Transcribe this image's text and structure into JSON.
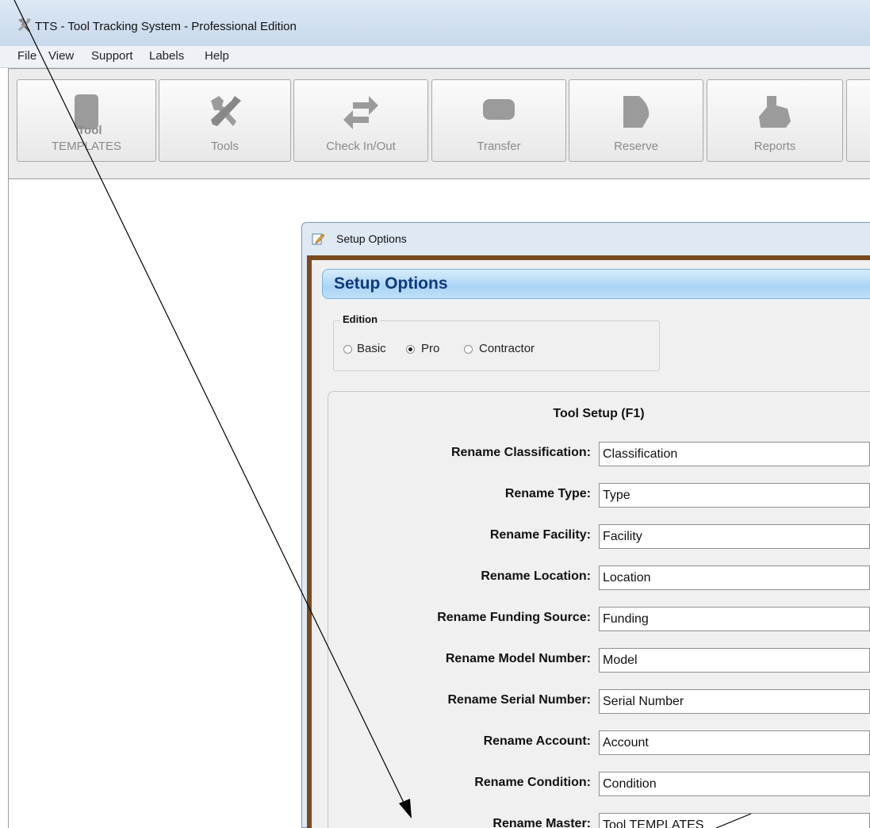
{
  "window": {
    "title": "TTS - Tool Tracking System - Professional Edition",
    "icon": "tools-app-icon"
  },
  "menu": {
    "items": [
      "File",
      "View",
      "Support",
      "Labels",
      "Help"
    ]
  },
  "toolbar": {
    "buttons": [
      {
        "label": "TEMPLATES",
        "overlay": "Tool",
        "icon": "template-icon"
      },
      {
        "label": "Tools",
        "icon": "wrench-screwdriver-icon"
      },
      {
        "label": "Check In/Out",
        "icon": "swap-arrows-icon"
      },
      {
        "label": "Transfer",
        "icon": "truck-icon"
      },
      {
        "label": "Reserve",
        "icon": "reserve-icon"
      },
      {
        "label": "Reports",
        "icon": "reports-icon"
      }
    ]
  },
  "dialog": {
    "title": "Setup Options",
    "header": "Setup Options",
    "edition": {
      "legend": "Edition",
      "options": [
        "Basic",
        "Pro",
        "Contractor"
      ],
      "selected": "Pro"
    },
    "tool_setup": {
      "title": "Tool Setup (F1)",
      "fields": [
        {
          "label": "Rename Classification:",
          "value": "Classification"
        },
        {
          "label": "Rename Type:",
          "value": "Type"
        },
        {
          "label": "Rename Facility:",
          "value": "Facility"
        },
        {
          "label": "Rename Location:",
          "value": "Location"
        },
        {
          "label": "Rename Funding Source:",
          "value": "Funding"
        },
        {
          "label": "Rename Model Number:",
          "value": "Model"
        },
        {
          "label": "Rename Serial Number:",
          "value": "Serial Number"
        },
        {
          "label": "Rename Account:",
          "value": "Account"
        },
        {
          "label": "Rename Condition:",
          "value": "Condition"
        },
        {
          "label": "Rename Master:",
          "value": "Tool TEMPLATES"
        }
      ]
    }
  },
  "colors": {
    "dialog_frame": "#7a4a1e",
    "header_text": "#103a7a",
    "header_bar": "#a9d4f5",
    "toolbar_icon": "#9b9b9b"
  }
}
